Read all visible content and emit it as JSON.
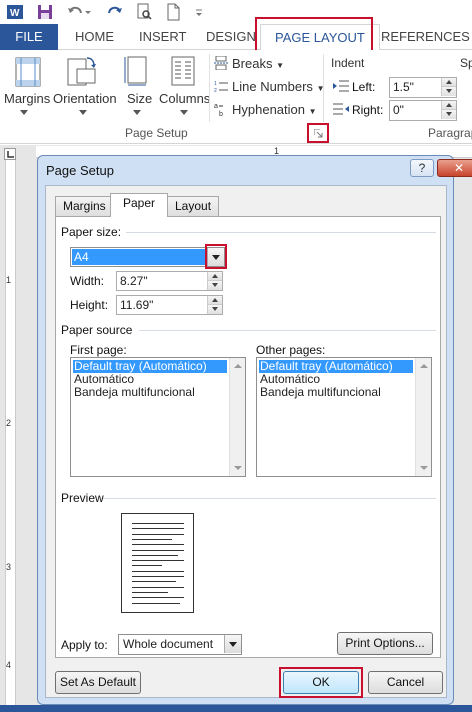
{
  "qat": {
    "icons": [
      "word-icon",
      "save-icon",
      "undo-icon",
      "redo-icon",
      "print-preview-icon",
      "new-document-icon",
      "customize-icon"
    ]
  },
  "ribbon_tabs": {
    "file": "FILE",
    "home": "HOME",
    "insert": "INSERT",
    "design": "DESIGN",
    "page_layout": "PAGE LAYOUT",
    "references": "REFERENCES"
  },
  "ribbon": {
    "margins": "Margins",
    "orientation": "Orientation",
    "size": "Size",
    "columns": "Columns",
    "breaks": "Breaks",
    "line_numbers": "Line Numbers",
    "hyphenation": "Hyphenation",
    "indent_title": "Indent",
    "left_label": "Left:",
    "left_value": "1.5\"",
    "right_label": "Right:",
    "right_value": "0\"",
    "spacing_partial": "Sp",
    "page_setup_group": "Page Setup",
    "paragraph_group": "Paragrap"
  },
  "ruler": {
    "h_mark": "1",
    "v_marks": [
      "1",
      "2",
      "3",
      "4"
    ]
  },
  "dialog": {
    "title": "Page Setup",
    "help": "?",
    "close": "✕",
    "tabs": [
      "Margins",
      "Paper",
      "Layout"
    ],
    "active_tab": "Paper",
    "paper_size_label": "Paper size:",
    "paper_size_value": "A4",
    "width_label": "Width:",
    "width_value": "8.27\"",
    "height_label": "Height:",
    "height_value": "11.69\"",
    "paper_source_label": "Paper source",
    "first_page_label": "First page:",
    "other_pages_label": "Other pages:",
    "first_page_options": [
      "Default tray (Automático)",
      "Automático",
      "Bandeja multifuncional"
    ],
    "other_pages_options": [
      "Default tray (Automático)",
      "Automático",
      "Bandeja multifuncional"
    ],
    "preview_label": "Preview",
    "apply_to_label": "Apply to:",
    "apply_to_value": "Whole document",
    "print_options": "Print Options...",
    "set_as_default": "Set As Default",
    "ok": "OK",
    "cancel": "Cancel"
  },
  "colors": {
    "file_tab": "#2b579a",
    "highlight": "#c8102e",
    "selection": "#3399ff",
    "dialog_frame": "#cfe0f4"
  }
}
